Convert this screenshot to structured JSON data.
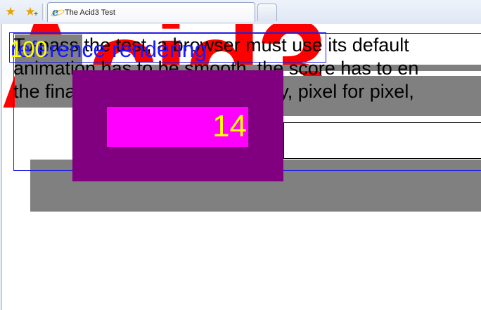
{
  "browser": {
    "toolbar": {
      "favorites_icon": "star-icon",
      "add_favorite_icon": "star-add-icon"
    },
    "tab": {
      "title": "The Acid3 Test",
      "icon": "ie-page-icon"
    },
    "new_tab_icon": "new-tab-icon"
  },
  "page": {
    "logo_text": "Acid3",
    "paragraph_lines": [
      "To pass the test, a browser must use its default",
      "animation has to be smooth, the score has to en",
      "the final page has to look exactly, pixel for pixel,"
    ],
    "reference_link": "reference rendering",
    "score_overlay": "100",
    "score_box": "14"
  },
  "colors": {
    "logo_red": "#ff0000",
    "gray": "#808080",
    "purple": "#800080",
    "magenta": "#ff00ff",
    "score_yellow": "#ffff00",
    "link_blue": "#1a1aff"
  }
}
